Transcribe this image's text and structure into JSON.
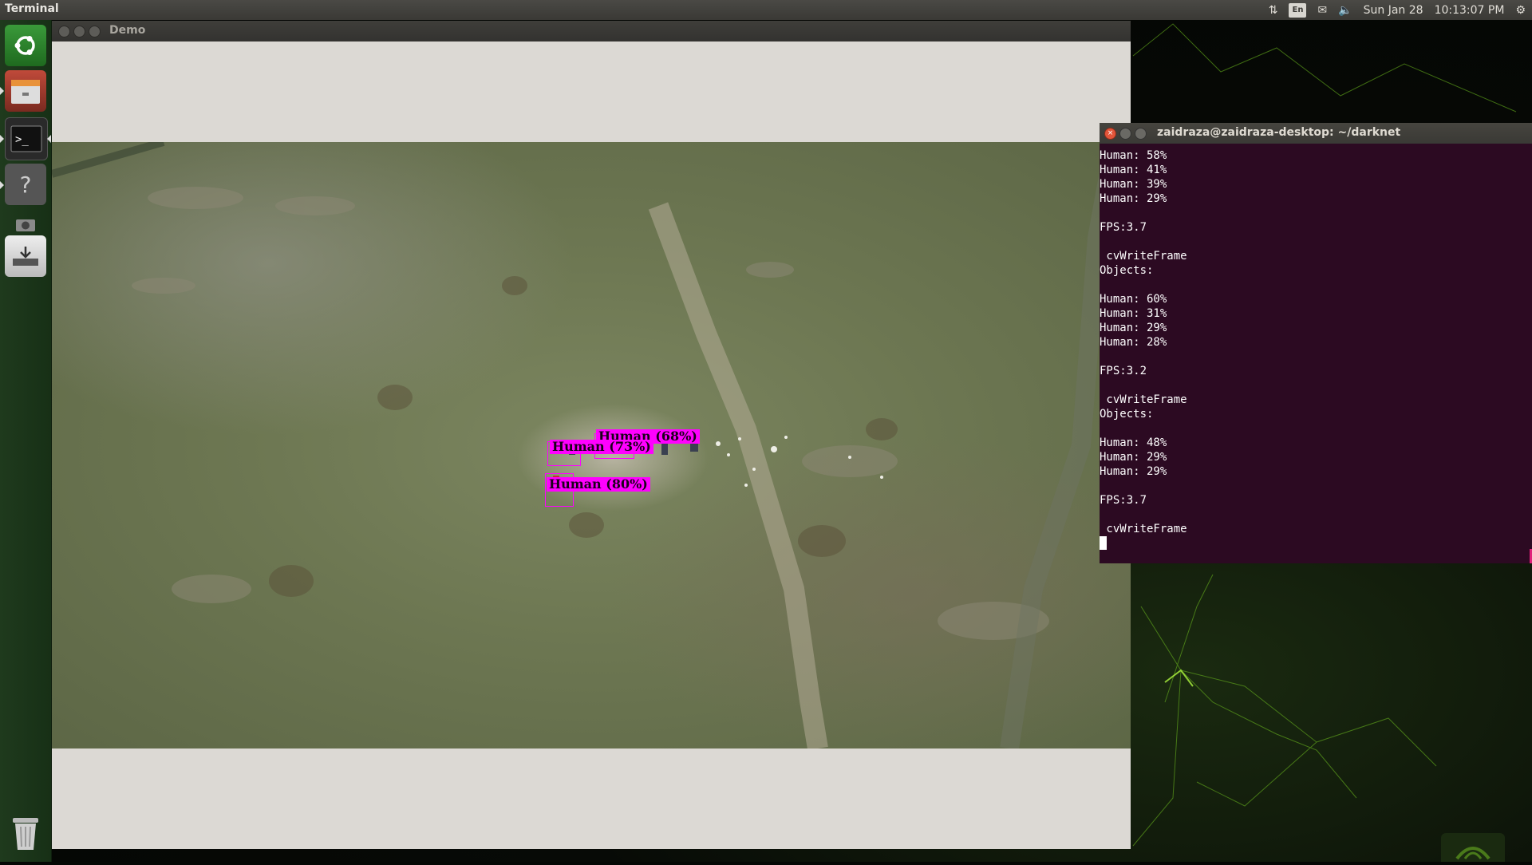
{
  "top_panel": {
    "app_title": "Terminal",
    "keyboard_layout": "En",
    "date": "Sun Jan 28",
    "time": "10:13:07 PM",
    "icons": [
      "network-transfer-icon",
      "keyboard-layout-icon",
      "mail-icon",
      "volume-icon",
      "settings-gear-icon"
    ]
  },
  "launcher": {
    "items": [
      "dash-home-icon",
      "files-icon",
      "terminal-icon",
      "help-icon",
      "camera-icon",
      "installer-icon",
      "trash-icon"
    ]
  },
  "demo_window": {
    "title": "Demo",
    "detections": [
      {
        "label": "Human (68%)"
      },
      {
        "label": "Human (73%)"
      },
      {
        "label": "Human (80%)"
      }
    ]
  },
  "terminal": {
    "title": "zaidraza@zaidraza-desktop: ~/darknet",
    "lines": [
      "Human: 58%",
      "Human: 41%",
      "Human: 39%",
      "Human: 29%",
      "",
      "FPS:3.7",
      "",
      " cvWriteFrame",
      "Objects:",
      "",
      "Human: 60%",
      "Human: 31%",
      "Human: 29%",
      "Human: 28%",
      "",
      "FPS:3.2",
      "",
      " cvWriteFrame",
      "Objects:",
      "",
      "Human: 48%",
      "Human: 29%",
      "Human: 29%",
      "",
      "FPS:3.7",
      "",
      " cvWriteFrame"
    ]
  },
  "colors": {
    "detection_magenta": "#ff00ff",
    "terminal_bg": "#2c0a22",
    "launcher_bg": "#1f3a1d"
  }
}
